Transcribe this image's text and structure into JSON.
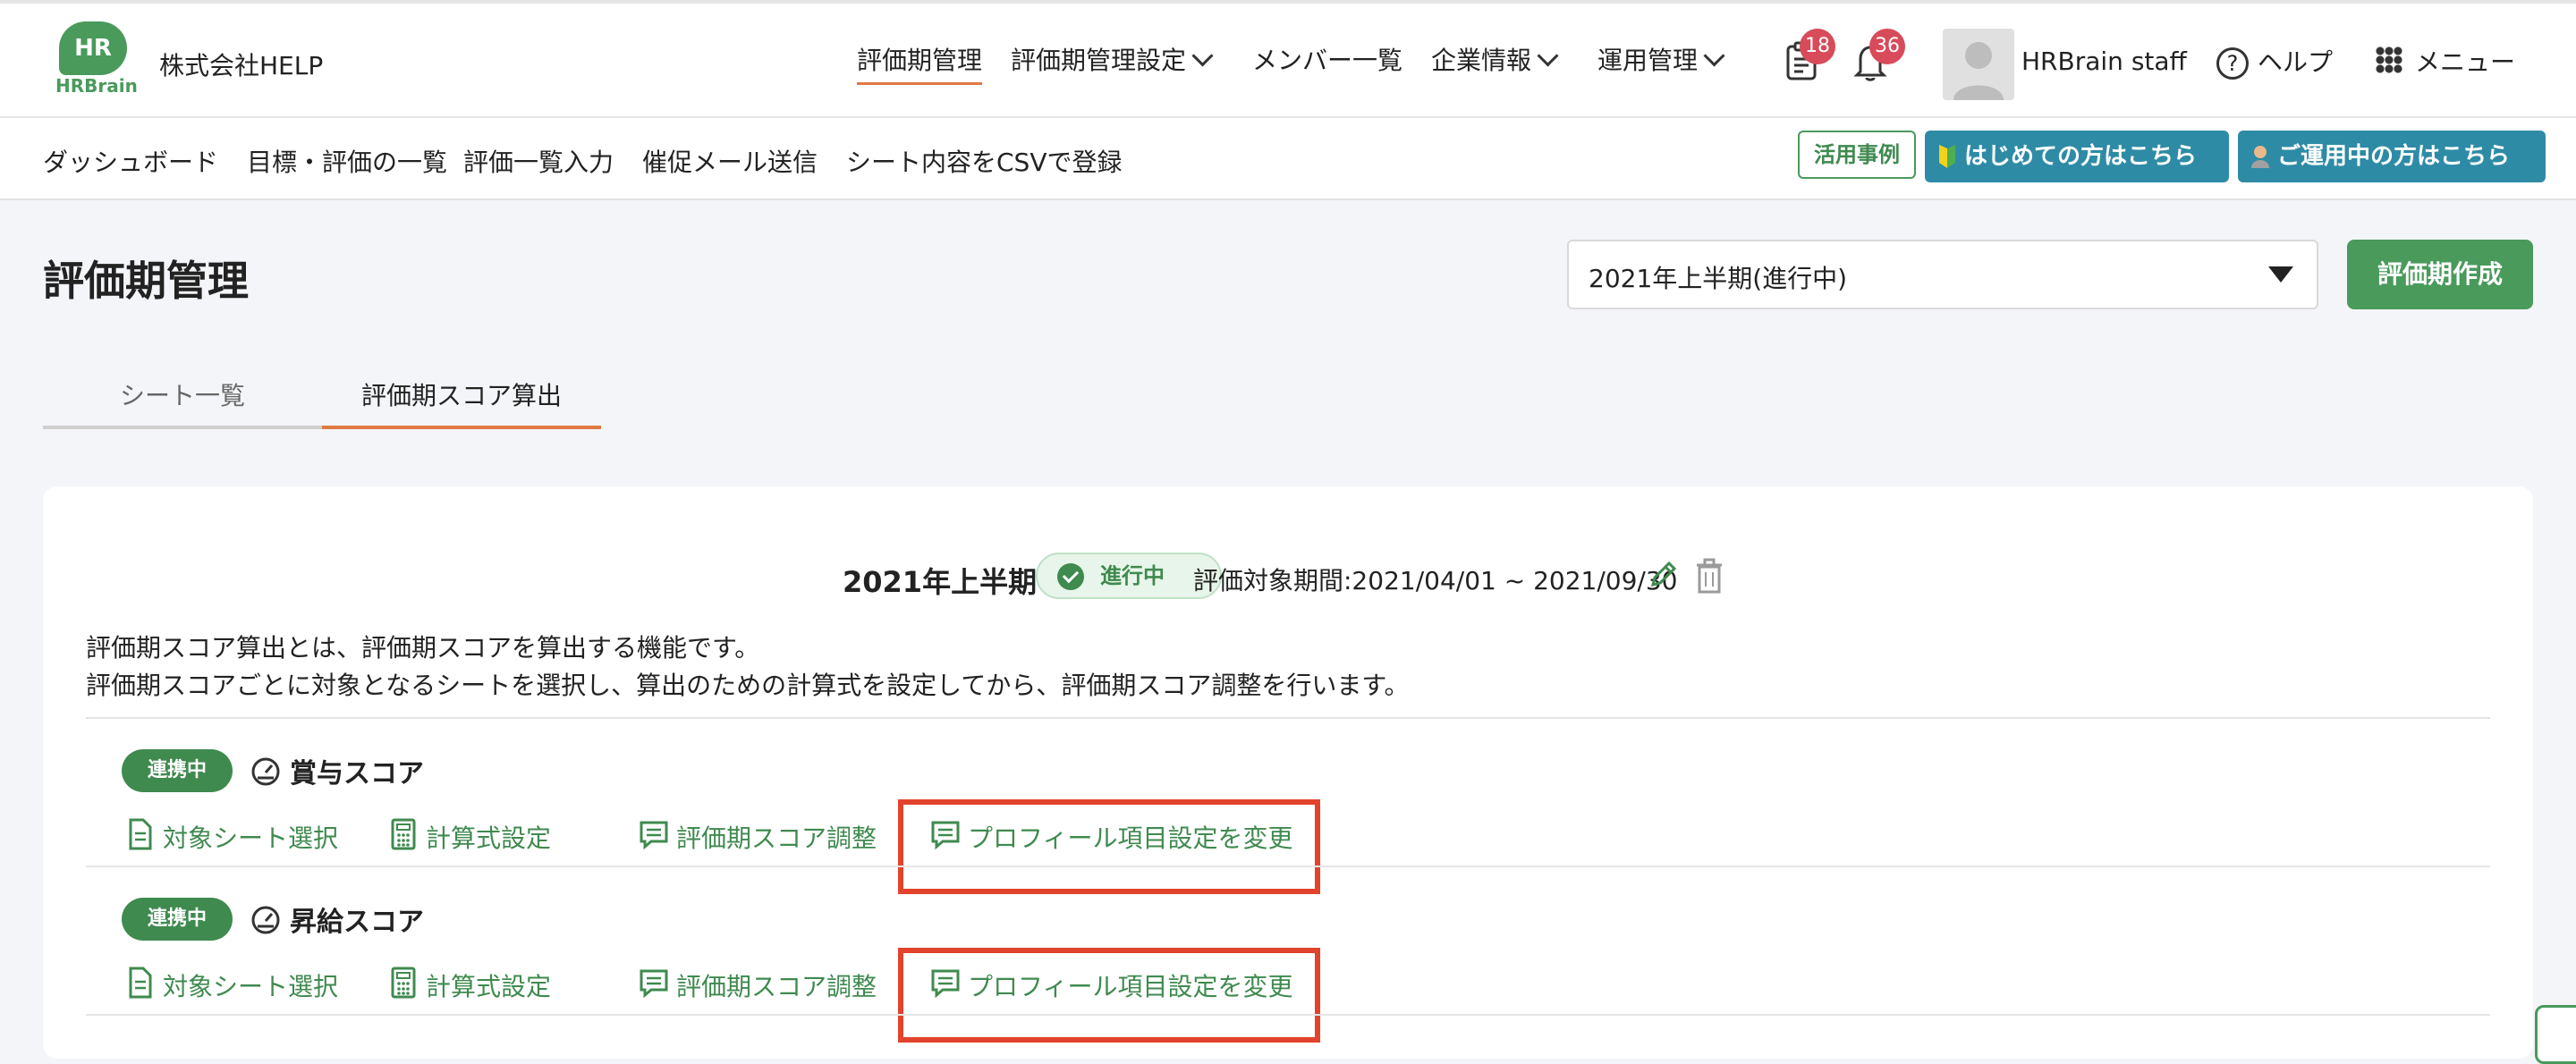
{
  "header": {
    "logo_text": "HR",
    "logo_sub": "HRBrain",
    "company": "株式会社HELP",
    "nav": [
      {
        "label": "評価期管理"
      },
      {
        "label": "評価期管理設定"
      },
      {
        "label": "メンバー一覧"
      },
      {
        "label": "企業情報"
      },
      {
        "label": "運用管理"
      }
    ],
    "tasks_badge": "18",
    "notifications_badge": "36",
    "user_name": "HRBrain staff",
    "help_label": "ヘルプ",
    "menu_label": "メニュー"
  },
  "subnav": {
    "items": [
      {
        "label": "ダッシュボード"
      },
      {
        "label": "目標・評価の一覧"
      },
      {
        "label": "評価一覧入力"
      },
      {
        "label": "催促メール送信"
      },
      {
        "label": "シート内容をCSVで登録"
      }
    ],
    "case_study": "活用事例",
    "beginners": "はじめての方はこちら",
    "current_users": "ご運用中の方はこちら"
  },
  "page": {
    "title": "評価期管理",
    "period_selected": "2021年上半期(進行中)",
    "create_button": "評価期作成"
  },
  "tabs": [
    {
      "label": "シート一覧"
    },
    {
      "label": "評価期スコア算出"
    }
  ],
  "card": {
    "period_name": "2021年上半期",
    "status": "進行中",
    "range": "評価対象期間:2021/04/01 ~ 2021/09/30",
    "desc_line1": "評価期スコア算出とは、評価期スコアを算出する機能です。",
    "desc_line2": "評価期スコアごとに対象となるシートを選択し、算出のための計算式を設定してから、評価期スコア調整を行います。",
    "scores": [
      {
        "chip": "連携中",
        "name": "賞与スコア",
        "links": [
          "対象シート選択",
          "計算式設定",
          "評価期スコア調整",
          "プロフィール項目設定を変更"
        ]
      },
      {
        "chip": "連携中",
        "name": "昇給スコア",
        "links": [
          "対象シート選択",
          "計算式設定",
          "評価期スコア調整",
          "プロフィール項目設定を変更"
        ]
      }
    ]
  },
  "colors": {
    "brand_green": "#4a9a5c",
    "accent_orange": "#e07a44",
    "teal": "#2e8ba6",
    "badge_red": "#d84b5a",
    "highlight_red": "#e2432c"
  }
}
